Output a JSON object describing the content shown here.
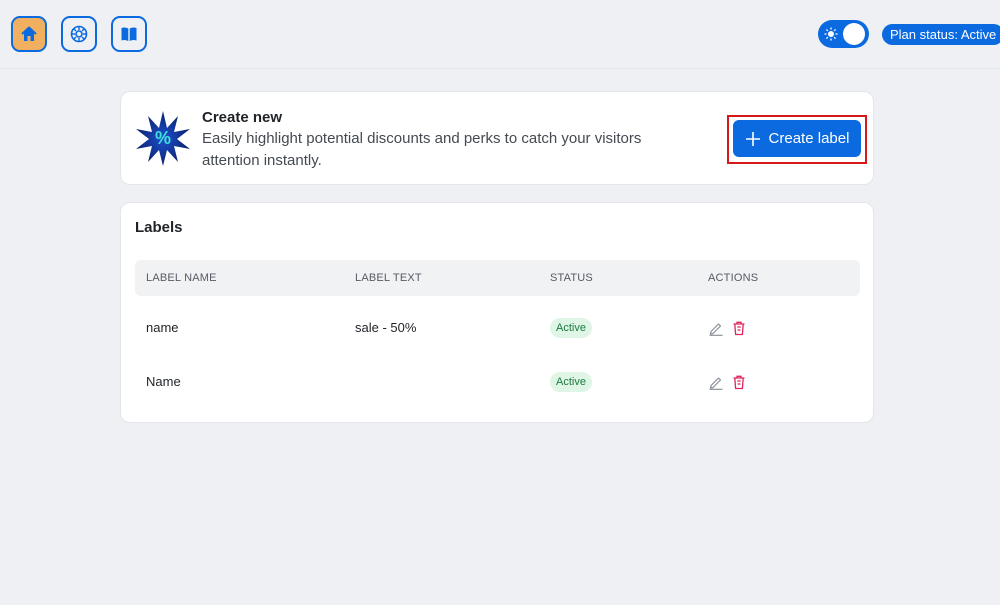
{
  "nav": {
    "items": [
      {
        "icon": "home-icon",
        "active": true
      },
      {
        "icon": "settings-icon",
        "active": false
      },
      {
        "icon": "book-icon",
        "active": false
      }
    ]
  },
  "theme_toggle": {
    "icon": "sun-icon",
    "on": true
  },
  "plan_status": "Plan status: Active",
  "create": {
    "icon": "discount-badge-icon",
    "title": "Create new",
    "description": "Easily highlight potential discounts and perks to catch your visitors attention instantly.",
    "button_label": "Create label",
    "button_icon": "plus-icon"
  },
  "labels": {
    "title": "Labels",
    "columns": [
      "LABEL NAME",
      "LABEL TEXT",
      "STATUS",
      "ACTIONS"
    ],
    "rows": [
      {
        "name": "name",
        "text": "sale - 50%",
        "status": "Active"
      },
      {
        "name": "Name",
        "text": "",
        "status": "Active"
      }
    ]
  },
  "colors": {
    "accent": "#0b6ae0",
    "nav_active": "#f0b060",
    "highlight_outline": "#d51818",
    "status_bg": "#dff5e6",
    "status_text": "#1b7a3d",
    "delete": "#e0245e",
    "background": "#eef0f3"
  }
}
